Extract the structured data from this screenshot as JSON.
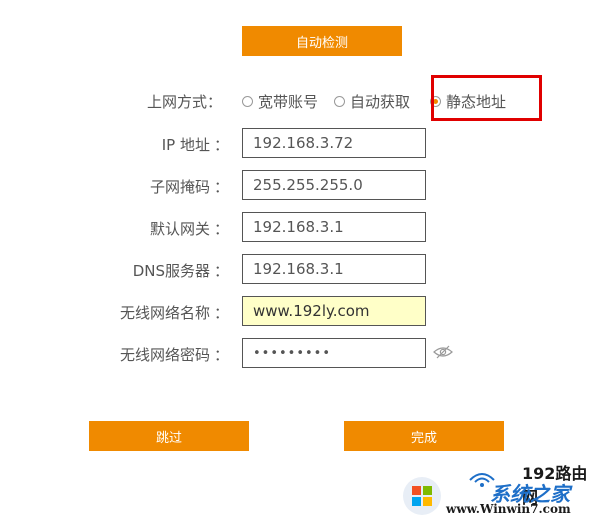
{
  "top": {
    "auto_detect_label": "自动检测"
  },
  "connection": {
    "label": "上网方式：",
    "options": [
      {
        "label": "宽带账号",
        "checked": false
      },
      {
        "label": "自动获取",
        "checked": false
      },
      {
        "label": "静态地址",
        "checked": true
      }
    ]
  },
  "fields": {
    "ip": {
      "label": "IP 地址",
      "value": "192.168.3.72"
    },
    "mask": {
      "label": "子网掩码",
      "value": "255.255.255.0"
    },
    "gateway": {
      "label": "默认网关",
      "value": "192.168.3.1"
    },
    "dns": {
      "label": "DNS服务器",
      "value": "192.168.3.1"
    },
    "ssid": {
      "label": "无线网络名称",
      "value": "www.192ly.com"
    },
    "password": {
      "label": "无线网络密码",
      "value": "•••••••••"
    }
  },
  "colon": "：",
  "buttons": {
    "skip": "跳过",
    "finish": "完成"
  },
  "watermark": {
    "site_name": "192路由网",
    "brand": "系统之家",
    "url": "www.Winwin7.com"
  },
  "colors": {
    "accent": "#f08a00",
    "highlight_border": "#e00000",
    "ssid_bg": "#ffffc8"
  }
}
